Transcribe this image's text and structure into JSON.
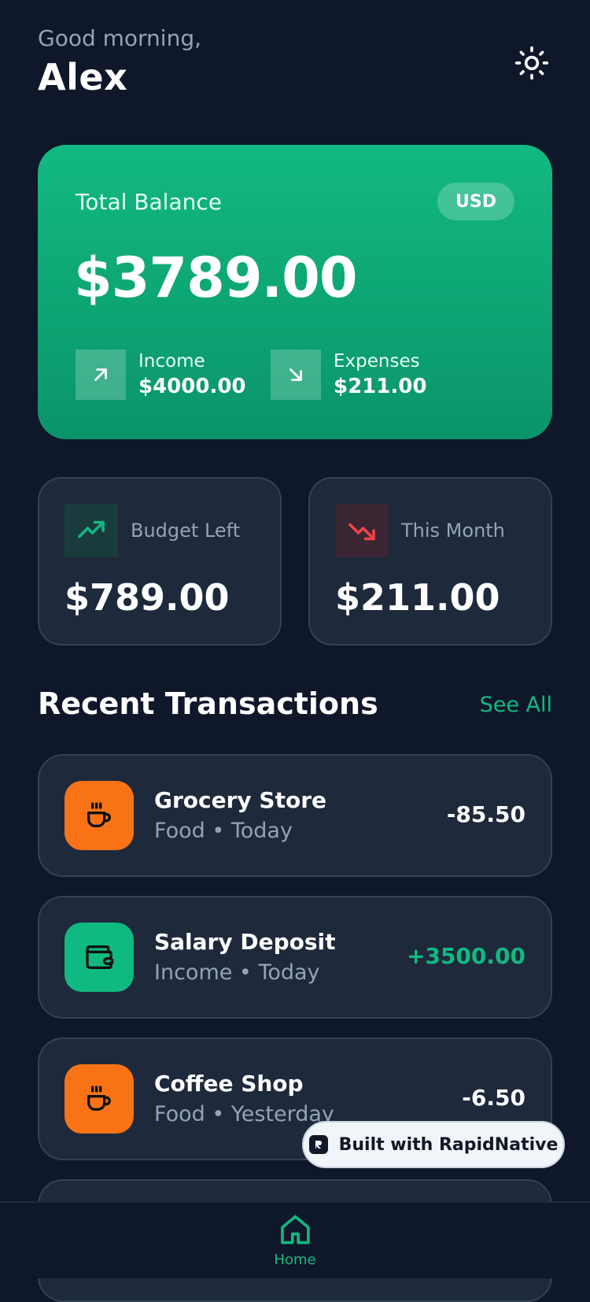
{
  "header": {
    "greeting": "Good morning,",
    "username": "Alex"
  },
  "balance": {
    "label": "Total Balance",
    "currency": "USD",
    "amount": "$3789.00",
    "income_label": "Income",
    "income_value": "$4000.00",
    "expenses_label": "Expenses",
    "expenses_value": "$211.00"
  },
  "stats": [
    {
      "label": "Budget Left",
      "value": "$789.00"
    },
    {
      "label": "This Month",
      "value": "$211.00"
    }
  ],
  "transactions_section": {
    "title": "Recent Transactions",
    "see_all": "See All"
  },
  "transactions": [
    {
      "name": "Grocery Store",
      "meta": "Food • Today",
      "amount": "-85.50",
      "icon": "coffee-cup-icon"
    },
    {
      "name": "Salary Deposit",
      "meta": "Income • Today",
      "amount": "+3500.00",
      "icon": "wallet-icon"
    },
    {
      "name": "Coffee Shop",
      "meta": "Food • Yesterday",
      "amount": "-6.50",
      "icon": "coffee-cup-icon"
    }
  ],
  "built_badge": "Built with RapidNative",
  "nav": {
    "home_label": "Home"
  },
  "colors": {
    "background": "#0f172a",
    "accent": "#10b981",
    "card": "#1e293b",
    "food": "#f97316",
    "negative": "#ef4444"
  }
}
